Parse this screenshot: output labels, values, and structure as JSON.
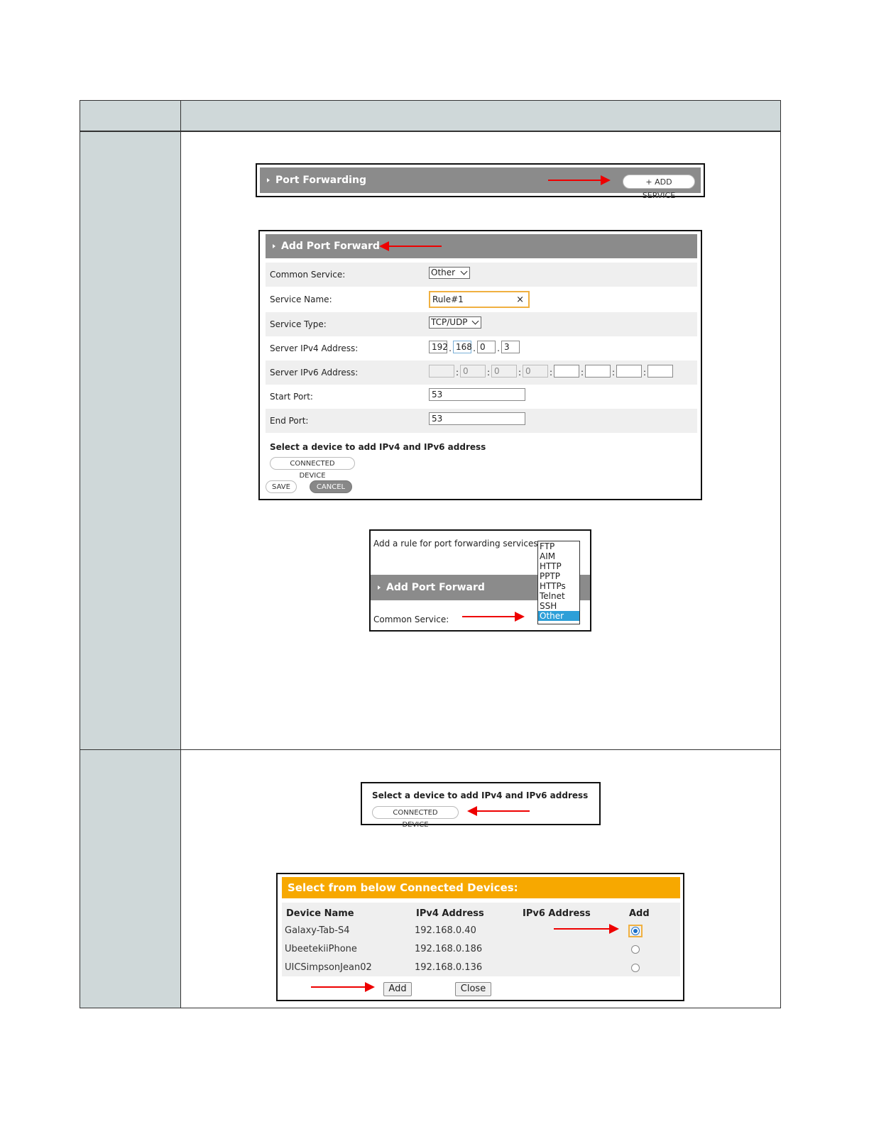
{
  "port_forwarding_bar": {
    "title": "Port Forwarding",
    "add_service": "+ ADD SERVICE"
  },
  "add_form": {
    "title": "Add Port Forward",
    "rows": {
      "common_service": {
        "label": "Common Service:",
        "value": "Other"
      },
      "service_name": {
        "label": "Service Name:",
        "value": "Rule#1",
        "clear": "×"
      },
      "service_type": {
        "label": "Service Type:",
        "value": "TCP/UDP"
      },
      "ipv4": {
        "label": "Server IPv4 Address:",
        "octets": [
          "192",
          "168",
          "0",
          "3"
        ]
      },
      "ipv6": {
        "label": "Server IPv6 Address:",
        "groups": [
          "",
          "0",
          "0",
          "0",
          "",
          "",
          "",
          ""
        ]
      },
      "start_port": {
        "label": "Start Port:",
        "value": "53"
      },
      "end_port": {
        "label": "End Port:",
        "value": "53"
      }
    },
    "select_device_text": "Select a device to add IPv4 and IPv6 address",
    "connected_device": "CONNECTED DEVICE",
    "save": "SAVE",
    "cancel": "CANCEL"
  },
  "dropdown_snip": {
    "intro": "Add a rule for port forwarding services",
    "title": "Add Port Forward",
    "label": "Common Service:",
    "options": [
      "FTP",
      "AIM",
      "HTTP",
      "PPTP",
      "HTTPs",
      "Telnet",
      "SSH",
      "Other"
    ],
    "selected": "Other"
  },
  "select_snip": {
    "text": "Select a device to add IPv4 and IPv6 address",
    "button": "CONNECTED DEVICE"
  },
  "devices": {
    "title": "Select from below Connected Devices:",
    "headers": [
      "Device Name",
      "IPv4 Address",
      "IPv6 Address",
      "Add"
    ],
    "rows": [
      {
        "name": "Galaxy-Tab-S4",
        "ipv4": "192.168.0.40",
        "ipv6": "",
        "checked": true
      },
      {
        "name": "UbeetekiiPhone",
        "ipv4": "192.168.0.186",
        "ipv6": "",
        "checked": false
      },
      {
        "name": "UICSimpsonJean02",
        "ipv4": "192.168.0.136",
        "ipv6": "",
        "checked": false
      }
    ],
    "add": "Add",
    "close": "Close"
  },
  "colors": {
    "header_grey": "#8b8b8b",
    "side_panel": "#cfd8d9",
    "orange": "#f7a800",
    "arrow": "#e00000",
    "selected": "#2d9fd8"
  }
}
